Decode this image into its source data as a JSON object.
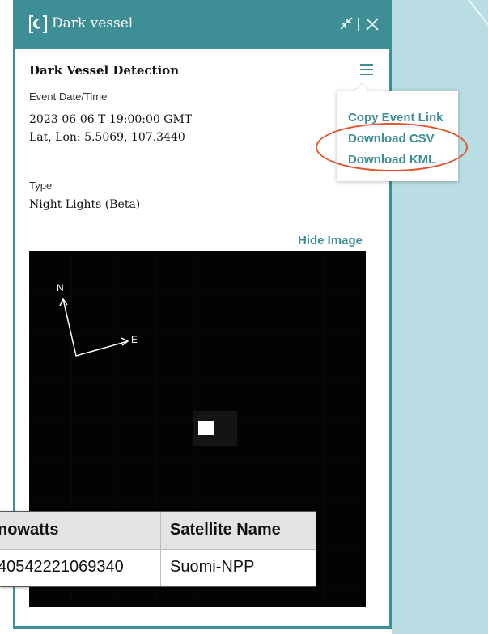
{
  "header": {
    "title": "Dark vessel",
    "logo_icon": "moon-bracket-icon",
    "minimize_icon": "minimize-arrows-icon",
    "close_icon": "close-icon"
  },
  "details": {
    "section_title": "Dark Vessel Detection",
    "menu_icon": "hamburger-menu-icon",
    "event_label": "Event Date/Time",
    "event_value": "2023-06-06 T 19:00:00 GMT",
    "latlon_value": "Lat, Lon: 5.5069, 107.3440",
    "type_label": "Type",
    "type_value": "Night Lights (Beta)"
  },
  "menu": {
    "items": [
      "Copy Event Link",
      "Download CSV",
      "Download KML"
    ]
  },
  "image": {
    "hide_label": "Hide Image",
    "compass_n": "N",
    "compass_e": "E"
  },
  "table": {
    "headers": [
      "nowatts",
      "Satellite Name"
    ],
    "row": [
      "40542221069340",
      "Suomi-NPP"
    ]
  },
  "colors": {
    "accent": "#3e8e95",
    "highlight": "#e0542e",
    "map": "#b9dde3"
  }
}
